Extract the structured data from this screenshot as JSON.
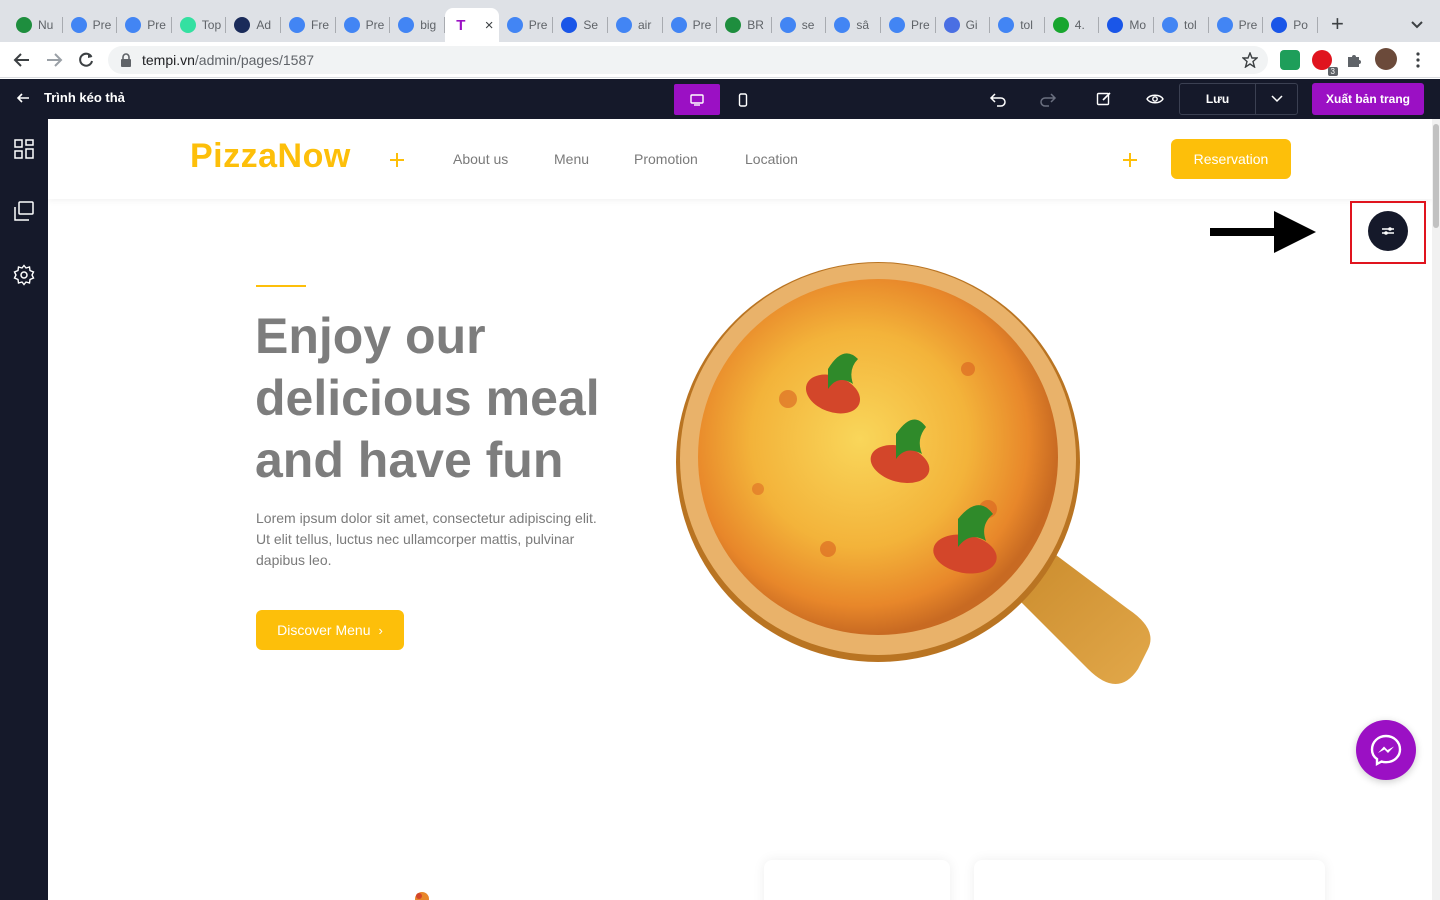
{
  "browser": {
    "tabs": [
      {
        "label": "Nu",
        "icon": "google-drive-icon",
        "color": "#1e8e3e"
      },
      {
        "label": "Pre",
        "icon": "bot-icon",
        "color": "#4285f4"
      },
      {
        "label": "Pre",
        "icon": "bot-icon",
        "color": "#4285f4"
      },
      {
        "label": "Top",
        "icon": "tripadvisor-icon",
        "color": "#34e0a1"
      },
      {
        "label": "Ad",
        "icon": "circle-logo-icon",
        "color": "#1a2b5a"
      },
      {
        "label": "Fre",
        "icon": "bot-icon",
        "color": "#4285f4"
      },
      {
        "label": "Pre",
        "icon": "bot-icon",
        "color": "#4285f4"
      },
      {
        "label": "big",
        "icon": "google-icon",
        "color": "#4285f4"
      },
      {
        "label": "T",
        "icon": "tempi-icon",
        "color": "#9b10c4",
        "active": true
      },
      {
        "label": "Pre",
        "icon": "bot-icon",
        "color": "#4285f4"
      },
      {
        "label": "Se",
        "icon": "puzzle-icon",
        "color": "#1a56e8"
      },
      {
        "label": "air",
        "icon": "google-icon",
        "color": "#4285f4"
      },
      {
        "label": "Pre",
        "icon": "bot-icon",
        "color": "#4285f4"
      },
      {
        "label": "BR",
        "icon": "google-drive-icon",
        "color": "#1e8e3e"
      },
      {
        "label": "se",
        "icon": "google-icon",
        "color": "#4285f4"
      },
      {
        "label": "sâ",
        "icon": "google-icon",
        "color": "#4285f4"
      },
      {
        "label": "Pre",
        "icon": "bot-icon",
        "color": "#4285f4"
      },
      {
        "label": "Gi",
        "icon": "graduation-cap-icon",
        "color": "#4a6fe3"
      },
      {
        "label": "tol",
        "icon": "google-icon",
        "color": "#4285f4"
      },
      {
        "label": "4.",
        "icon": "w-icon",
        "color": "#18a62e"
      },
      {
        "label": "Mo",
        "icon": "puzzle-icon",
        "color": "#1a56e8"
      },
      {
        "label": "tol",
        "icon": "google-icon",
        "color": "#4285f4"
      },
      {
        "label": "Pre",
        "icon": "bot-icon",
        "color": "#4285f4"
      },
      {
        "label": "Po",
        "icon": "puzzle-icon",
        "color": "#1a56e8"
      }
    ],
    "url_host": "tempi.vn",
    "url_path": "/admin/pages/1587",
    "extension_badge": "3"
  },
  "editor": {
    "title": "Trình kéo thả",
    "save_label": "Lưu",
    "publish_label": "Xuất bản trang",
    "accent": "#9b10c4",
    "bar_color": "#15192a"
  },
  "site": {
    "logo": "PizzaNow",
    "nav": [
      "About us",
      "Menu",
      "Promotion",
      "Location"
    ],
    "reservation_label": "Reservation",
    "hero_title": "Enjoy our delicious meal and have fun",
    "hero_text": "Lorem ipsum dolor sit amet, consectetur adipiscing elit. Ut elit tellus, luctus nec ullamcorper mattis, pulvinar dapibus leo.",
    "discover_label": "Discover Menu",
    "brand_color": "#fdbf0a"
  }
}
